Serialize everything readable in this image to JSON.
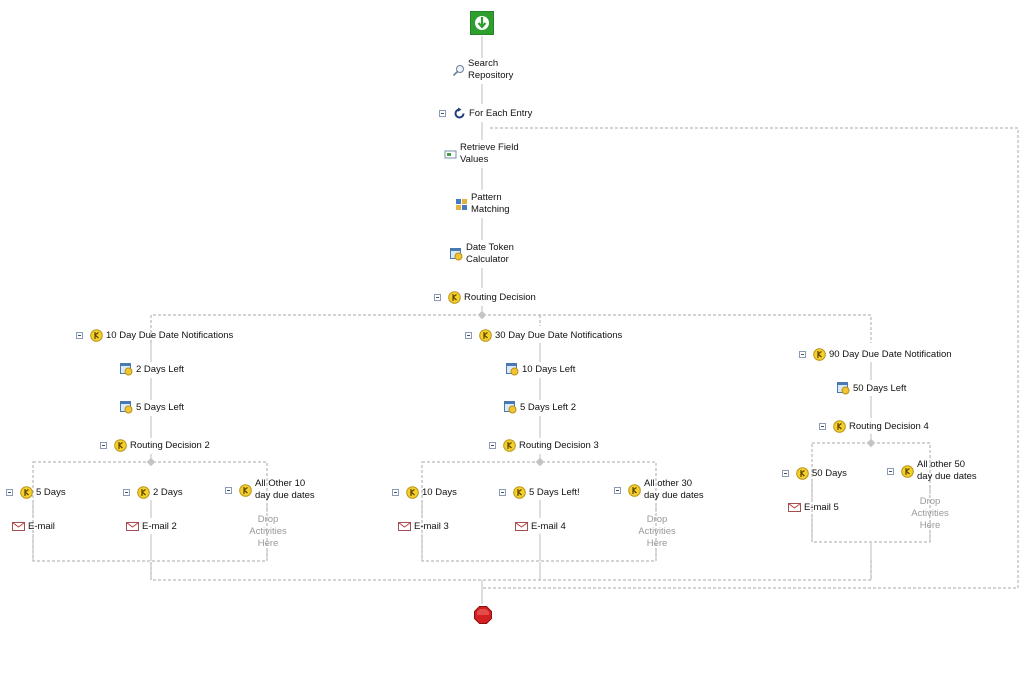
{
  "workflow": {
    "start_icon": "start-arrow-icon",
    "end_icon": "stop-octagon-icon",
    "search_repository": "Search\nRepository",
    "for_each_entry": "For Each Entry",
    "retrieve_field_values": "Retrieve Field\nValues",
    "pattern_matching": "Pattern\nMatching",
    "date_token_calculator": "Date Token\nCalculator",
    "routing_decision": "Routing Decision",
    "branches": {
      "b10": {
        "title": "10 Day Due Date Notifications",
        "step1": "2 Days Left",
        "step2": "5 Days Left",
        "decision": "Routing Decision 2",
        "c1": "5 Days",
        "c1_email": "E-mail",
        "c2": "2 Days",
        "c2_email": "E-mail 2",
        "c3": "All Other 10\nday due dates",
        "c3_drop": "Drop\nActivities\nHere"
      },
      "b30": {
        "title": "30 Day Due Date Notifications",
        "step1": "10 Days Left",
        "step2": "5 Days Left 2",
        "decision": "Routing Decision 3",
        "c1": "10 Days",
        "c1_email": "E-mail 3",
        "c2": "5 Days Left!",
        "c2_email": "E-mail 4",
        "c3": "All other 30\nday due dates",
        "c3_drop": "Drop\nActivities\nHere"
      },
      "b90": {
        "title": "90 Day Due Date Notification",
        "step1": "50 Days Left",
        "decision": "Routing Decision 4",
        "c1": "50 Days",
        "c1_email": "E-mail 5",
        "c2": "All other 50\nday due dates",
        "c2_drop": "Drop\nActivities\nHere"
      }
    },
    "colors": {
      "start_green": "#2e9e2e",
      "end_red": "#d42020",
      "connector": "#b9b9b9",
      "dashed": "#a8a8a8",
      "drop_text": "#999999"
    }
  }
}
